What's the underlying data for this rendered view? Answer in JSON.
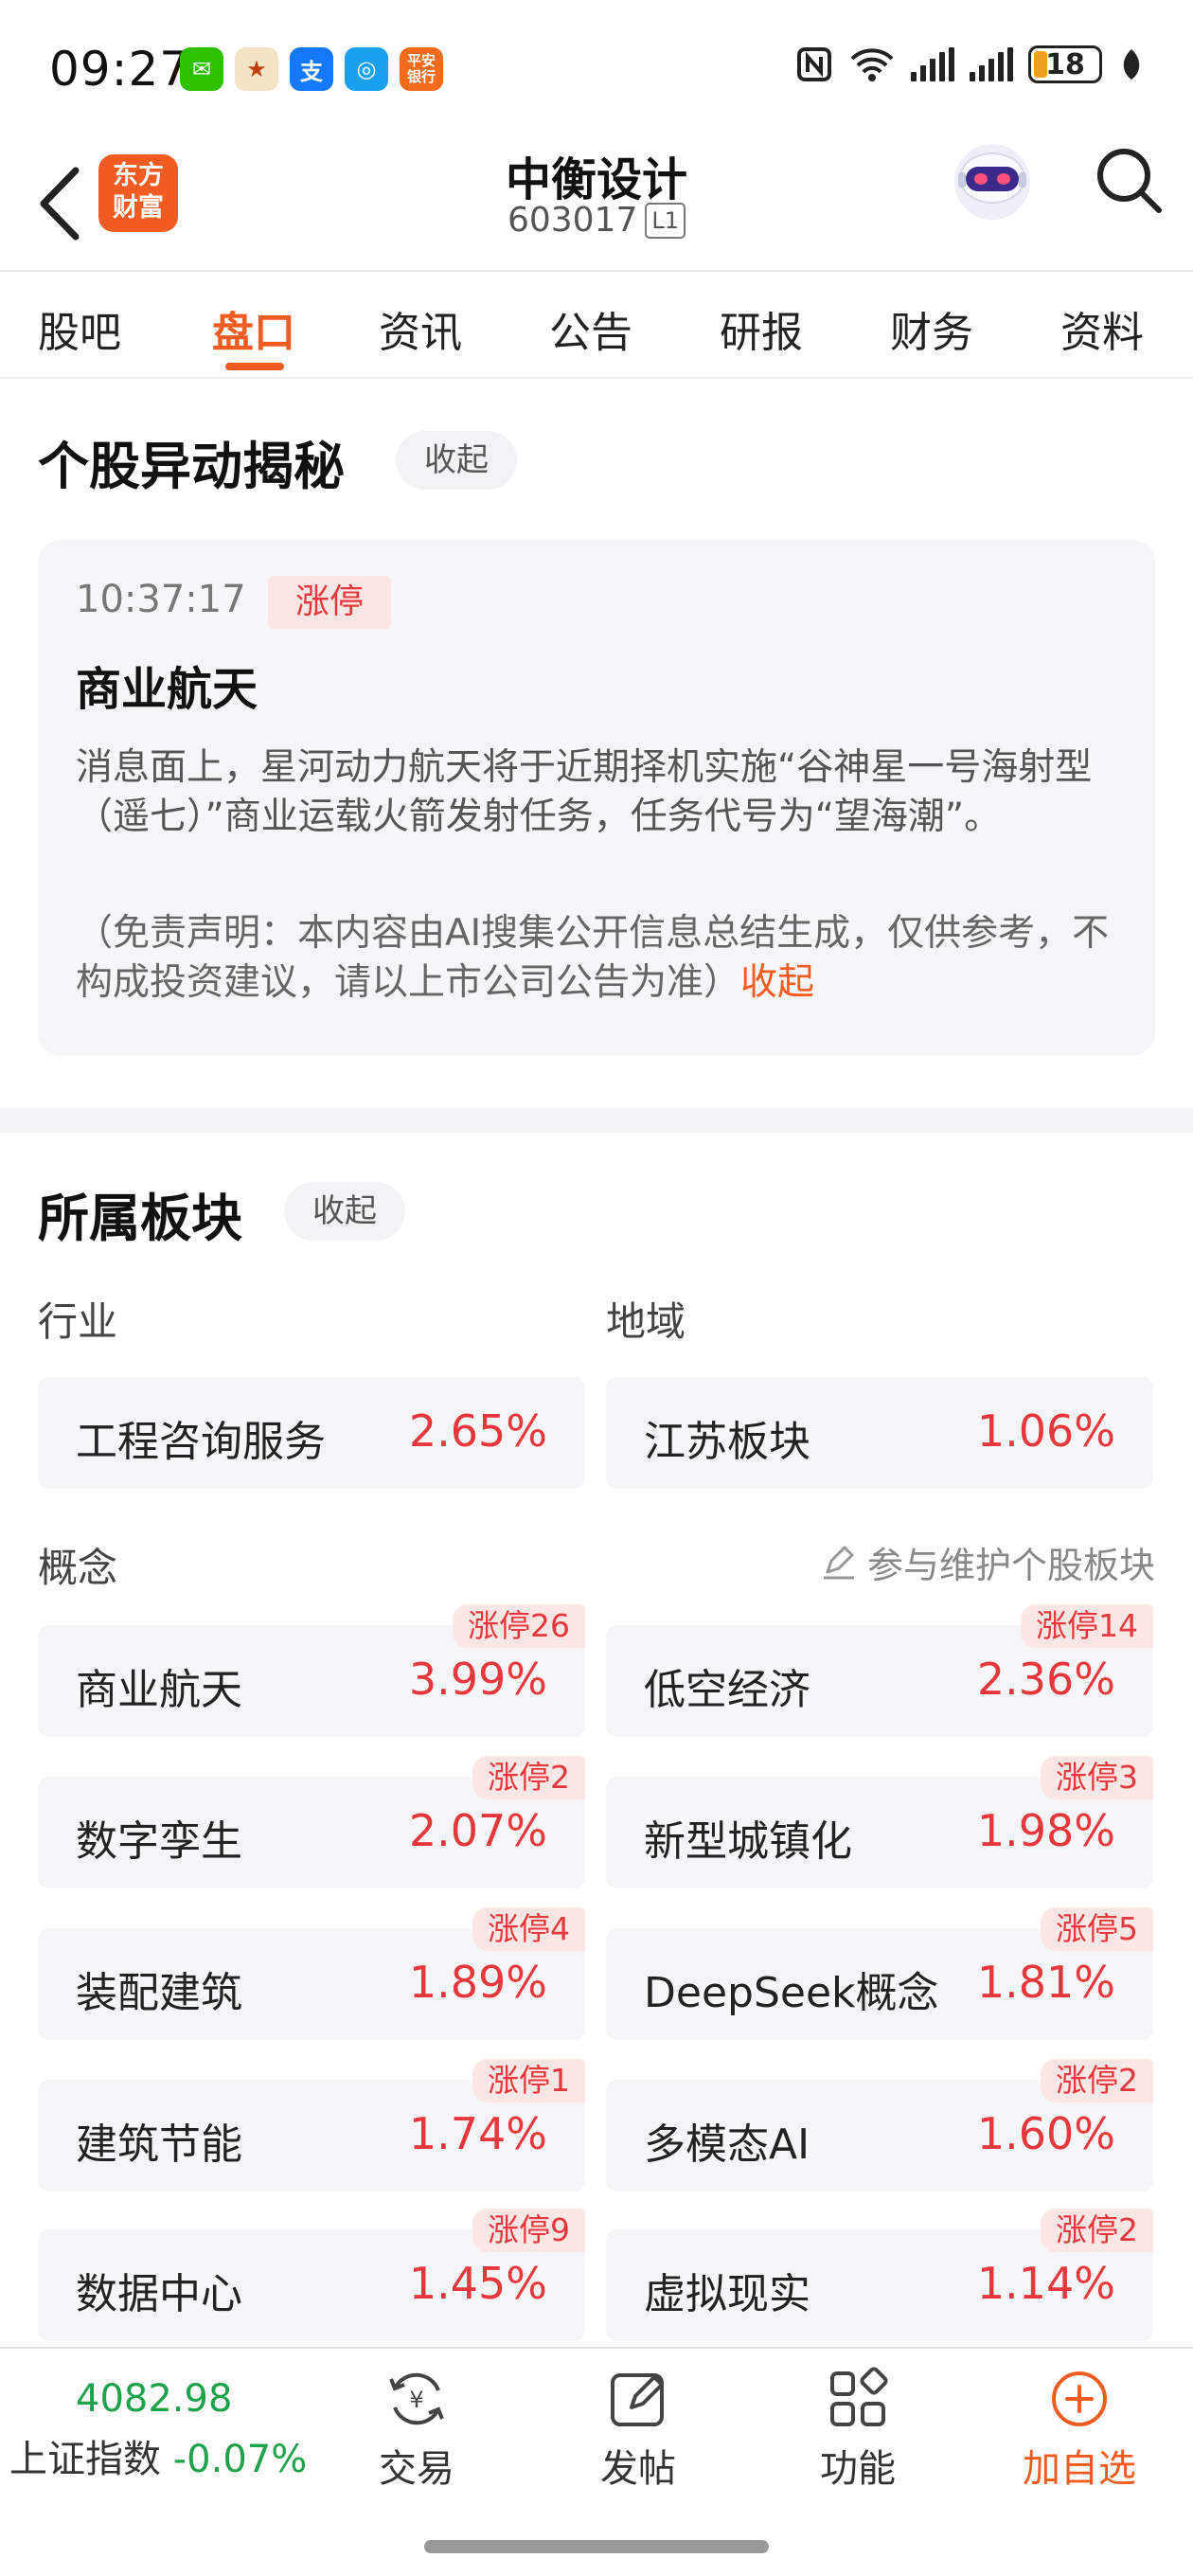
{
  "status": {
    "time": "09:27",
    "battery": "18",
    "apps": [
      "wechat-icon",
      "tmall-icon",
      "alipay-icon",
      "pay-icon",
      "pingan-bank-icon"
    ]
  },
  "header": {
    "brand_line1": "东方",
    "brand_line2": "财富",
    "stock_name": "中衡设计",
    "stock_code": "603017",
    "level": "L1"
  },
  "tabs": [
    "股吧",
    "盘口",
    "资讯",
    "公告",
    "研报",
    "财务",
    "资料"
  ],
  "active_tab": "盘口",
  "movement": {
    "title": "个股异动揭秘",
    "collapse": "收起",
    "time": "10:37:17",
    "tag": "涨停",
    "headline": "商业航天",
    "body": "消息面上，星河动力航天将于近期择机实施“谷神星一号海射型（遥七）”商业运载火箭发射任务，任务代号为“望海潮”。",
    "disclaimer": "（免责声明：本内容由AI搜集公开信息总结生成，仅供参考，不构成投资建议，请以上市公司公告为准）",
    "disclaimer_collapse": "收起"
  },
  "sectors": {
    "title": "所属板块",
    "collapse": "收起",
    "industry_label": "行业",
    "region_label": "地域",
    "industry": {
      "name": "工程咨询服务",
      "pct": "2.65%"
    },
    "region": {
      "name": "江苏板块",
      "pct": "1.06%"
    },
    "concept_label": "概念",
    "maintain": "参与维护个股板块",
    "concepts": [
      {
        "name": "商业航天",
        "pct": "3.99%",
        "badge": "涨停26"
      },
      {
        "name": "低空经济",
        "pct": "2.36%",
        "badge": "涨停14"
      },
      {
        "name": "数字孪生",
        "pct": "2.07%",
        "badge": "涨停2"
      },
      {
        "name": "新型城镇化",
        "pct": "1.98%",
        "badge": "涨停3"
      },
      {
        "name": "装配建筑",
        "pct": "1.89%",
        "badge": "涨停4"
      },
      {
        "name": "DeepSeek概念",
        "pct": "1.81%",
        "badge": "涨停5"
      },
      {
        "name": "建筑节能",
        "pct": "1.74%",
        "badge": "涨停1"
      },
      {
        "name": "多模态AI",
        "pct": "1.60%",
        "badge": "涨停2"
      },
      {
        "name": "数据中心",
        "pct": "1.45%",
        "badge": "涨停9"
      },
      {
        "name": "虚拟现实",
        "pct": "1.14%",
        "badge": "涨停2"
      }
    ]
  },
  "bottom": {
    "index_value": "4082.98",
    "index_name": "上证指数",
    "index_change": "-0.07%",
    "nav": [
      "交易",
      "发帖",
      "功能",
      "加自选"
    ]
  },
  "colors": {
    "accent": "#f25c22",
    "up": "#e8383d",
    "down": "#1fa34a"
  }
}
